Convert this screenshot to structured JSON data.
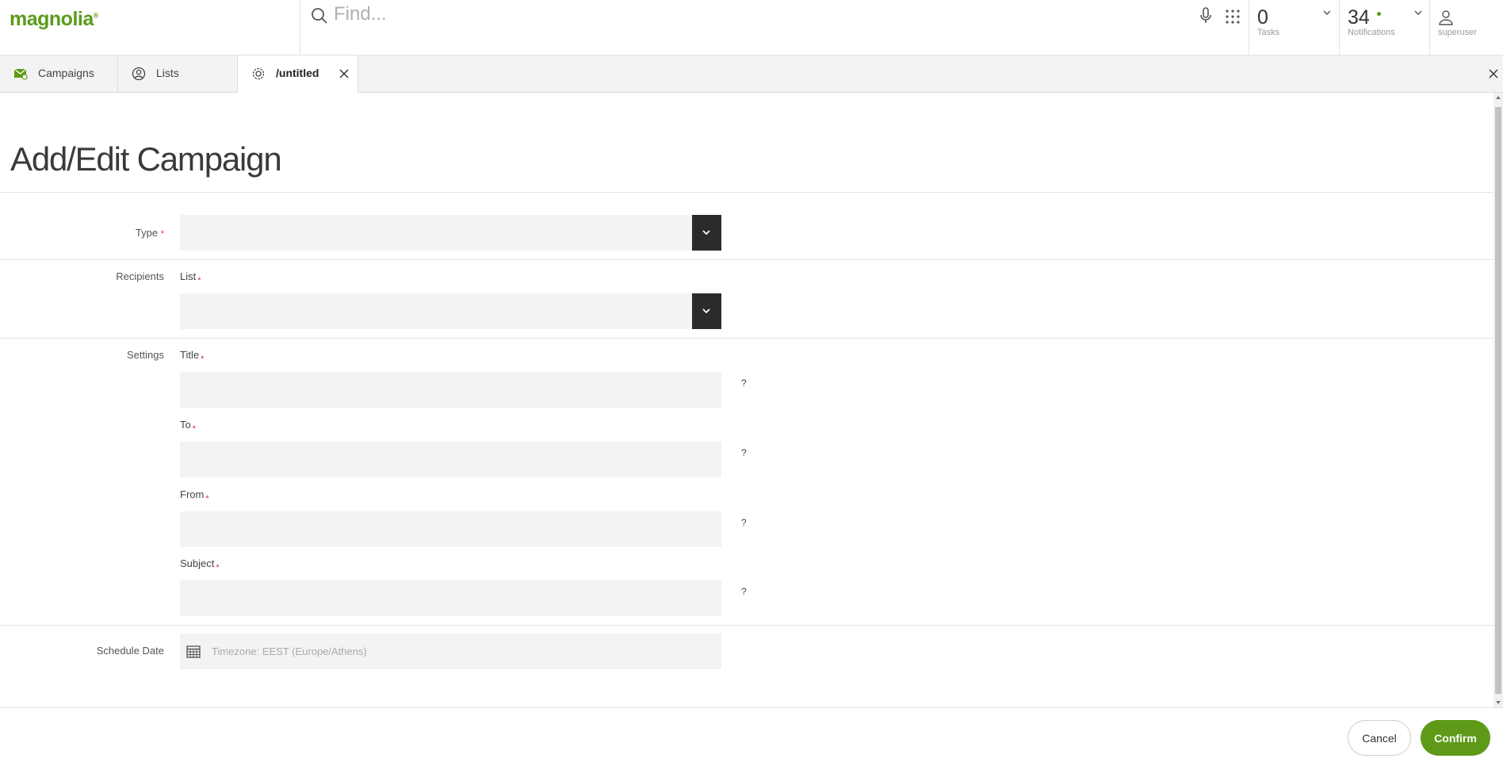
{
  "app": {
    "logo_text": "magnolia",
    "logo_mark": "®"
  },
  "search": {
    "placeholder": "Find...",
    "value": ""
  },
  "topbar": {
    "tasks": {
      "count": "0",
      "label": "Tasks"
    },
    "notifications": {
      "count": "34",
      "label": "Notifications"
    },
    "user": {
      "name": "superuser"
    }
  },
  "tabs": [
    {
      "label": "Campaigns",
      "icon": "mail-campaign-icon",
      "active": false
    },
    {
      "label": "Lists",
      "icon": "user-circle-icon",
      "active": false
    },
    {
      "label": "/untitled",
      "icon": "gear-icon",
      "active": true
    }
  ],
  "form": {
    "title": "Add/Edit Campaign",
    "type": {
      "label": "Type",
      "required_mark": "*",
      "value": ""
    },
    "recipients": {
      "label": "Recipients",
      "list_label": "List",
      "required_mark": "*",
      "value": ""
    },
    "settings": {
      "label": "Settings",
      "fields": [
        {
          "label": "Title",
          "required_mark": "*",
          "value": "",
          "help": "?"
        },
        {
          "label": "To",
          "required_mark": "*",
          "value": "",
          "help": "?"
        },
        {
          "label": "From",
          "required_mark": "*",
          "value": "",
          "help": "?"
        },
        {
          "label": "Subject",
          "required_mark": "*",
          "value": "",
          "help": "?"
        }
      ]
    },
    "schedule": {
      "label": "Schedule Date",
      "placeholder": "Timezone: EEST (Europe/Athens)",
      "value": ""
    }
  },
  "footer": {
    "cancel_label": "Cancel",
    "confirm_label": "Confirm"
  },
  "colors": {
    "brand_green": "#5e9a17",
    "select_button": "#2b2b2b",
    "field_bg": "#f3f3f3",
    "required": "#dd3333"
  }
}
